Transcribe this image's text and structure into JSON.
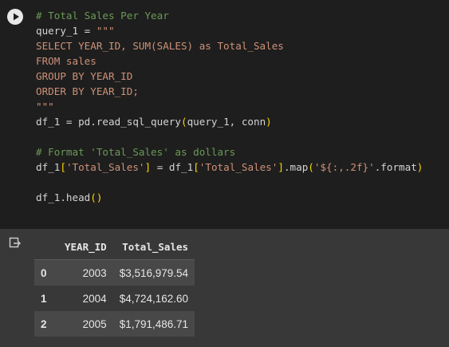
{
  "code_lines": [
    [
      {
        "t": "# Total Sales Per Year",
        "c": "comment"
      }
    ],
    [
      {
        "t": "query_1 = ",
        "c": "plain"
      },
      {
        "t": "\"\"\"",
        "c": "str"
      }
    ],
    [
      {
        "t": "SELECT YEAR_ID, SUM(SALES) as Total_Sales",
        "c": "str"
      }
    ],
    [
      {
        "t": "FROM sales",
        "c": "str"
      }
    ],
    [
      {
        "t": "GROUP BY YEAR_ID",
        "c": "str"
      }
    ],
    [
      {
        "t": "ORDER BY YEAR_ID;",
        "c": "str"
      }
    ],
    [
      {
        "t": "\"\"\"",
        "c": "str"
      }
    ],
    [
      {
        "t": "df_1 = pd.read_sql_query",
        "c": "plain"
      },
      {
        "t": "(",
        "c": "bracket"
      },
      {
        "t": "query_1, conn",
        "c": "plain"
      },
      {
        "t": ")",
        "c": "bracket"
      }
    ],
    [
      {
        "t": "",
        "c": "plain"
      }
    ],
    [
      {
        "t": "# Format 'Total_Sales' as dollars",
        "c": "comment"
      }
    ],
    [
      {
        "t": "df_1",
        "c": "plain"
      },
      {
        "t": "[",
        "c": "bracket"
      },
      {
        "t": "'Total_Sales'",
        "c": "str"
      },
      {
        "t": "]",
        "c": "bracket"
      },
      {
        "t": " = df_1",
        "c": "plain"
      },
      {
        "t": "[",
        "c": "bracket"
      },
      {
        "t": "'Total_Sales'",
        "c": "str"
      },
      {
        "t": "]",
        "c": "bracket"
      },
      {
        "t": ".map",
        "c": "plain"
      },
      {
        "t": "(",
        "c": "bracket"
      },
      {
        "t": "'${:,.2f}'",
        "c": "str"
      },
      {
        "t": ".format",
        "c": "plain"
      },
      {
        "t": ")",
        "c": "bracket"
      }
    ],
    [
      {
        "t": "",
        "c": "plain"
      }
    ],
    [
      {
        "t": "df_1.head",
        "c": "plain"
      },
      {
        "t": "()",
        "c": "bracket"
      }
    ]
  ],
  "run_button_icon": "play-icon",
  "output_icon": "output-redirect-icon",
  "table": {
    "columns": [
      "",
      "YEAR_ID",
      "Total_Sales"
    ],
    "rows": [
      [
        "0",
        "2003",
        "$3,516,979.54"
      ],
      [
        "1",
        "2004",
        "$4,724,162.60"
      ],
      [
        "2",
        "2005",
        "$1,791,486.71"
      ]
    ]
  },
  "colors": {
    "editor_bg": "#1e1e1e",
    "output_bg": "#383838",
    "comment": "#6a9955",
    "string": "#ce9178",
    "bracket": "#ffd700",
    "text": "#d4d4d4"
  }
}
